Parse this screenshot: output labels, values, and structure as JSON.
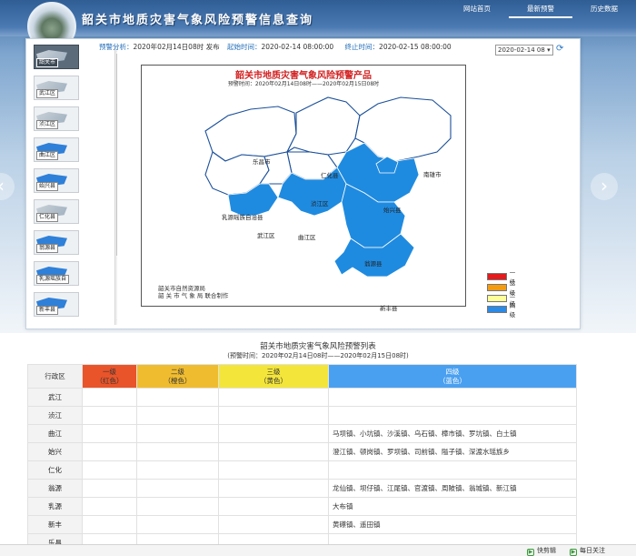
{
  "header": {
    "title": "韶关市地质灾害气象风险预警信息查询"
  },
  "nav": [
    {
      "label": "网站首页"
    },
    {
      "label": "最新预警"
    },
    {
      "label": "历史数据"
    }
  ],
  "thumbs": [
    {
      "label": "韶关市"
    },
    {
      "label": "武江区"
    },
    {
      "label": "浈江区"
    },
    {
      "label": "曲江区"
    },
    {
      "label": "始兴县"
    },
    {
      "label": "仁化县"
    },
    {
      "label": "翁源县"
    },
    {
      "label": "乳源瑶族自"
    },
    {
      "label": "新丰县"
    }
  ],
  "meta": {
    "forecast_label": "预警分析：",
    "forecast_value": "2020年02月14日08时 发布",
    "start_label": "起始时间：",
    "start_value": "2020-02-14 08:00:00",
    "end_label": "终止时间：",
    "end_value": "2020-02-15 08:00:00",
    "date_select": "2020-02-14 08"
  },
  "map": {
    "title": "韶关市地质灾害气象风险预警产品",
    "subtitle": "预警时间：2020年02月14日08时——2020年02月15日08时",
    "labels": [
      {
        "text": "乐昌市"
      },
      {
        "text": "仁化县"
      },
      {
        "text": "南雄市"
      },
      {
        "text": "浈江区"
      },
      {
        "text": "始兴县"
      },
      {
        "text": "乳源瑶族自治县"
      },
      {
        "text": "武江区"
      },
      {
        "text": "曲江区"
      },
      {
        "text": "翁源县"
      },
      {
        "text": "新丰县"
      }
    ],
    "credit_1": "韶关市自然资源局",
    "credit_2": "韶 关 市 气 象 局",
    "credit_3": "联合制作",
    "colors": {
      "region": "#1f8be0",
      "border": "#ffffff",
      "land": "#ffffff"
    }
  },
  "legend": [
    {
      "label": "一级",
      "color": "#e41a1c"
    },
    {
      "label": "二级",
      "color": "#f39c12"
    },
    {
      "label": "三级",
      "color": "#ffff99"
    },
    {
      "label": "四级",
      "color": "#2b8ae6"
    }
  ],
  "table": {
    "title": "韶关市地质灾害气象风险预警列表",
    "subtitle": "(预警时间：2020年02月14日08时——2020年02月15日08时)",
    "headers": [
      {
        "main": "行政区",
        "sub": ""
      },
      {
        "main": "一级",
        "sub": "（红色）"
      },
      {
        "main": "二级",
        "sub": "（橙色）"
      },
      {
        "main": "三级",
        "sub": "（黄色）"
      },
      {
        "main": "四级",
        "sub": "（蓝色）"
      }
    ],
    "rows": [
      {
        "region": "武江",
        "l1": "",
        "l2": "",
        "l3": "",
        "l4": ""
      },
      {
        "region": "浈江",
        "l1": "",
        "l2": "",
        "l3": "",
        "l4": ""
      },
      {
        "region": "曲江",
        "l1": "",
        "l2": "",
        "l3": "",
        "l4": "马坝镇、小坑镇、沙溪镇、乌石镇、樟市镇、罗坑镇、白土镇"
      },
      {
        "region": "始兴",
        "l1": "",
        "l2": "",
        "l3": "",
        "l4": "澄江镇、顿岗镇、罗坝镇、司前镇、隘子镇、深渡水瑶族乡"
      },
      {
        "region": "仁化",
        "l1": "",
        "l2": "",
        "l3": "",
        "l4": ""
      },
      {
        "region": "翁源",
        "l1": "",
        "l2": "",
        "l3": "",
        "l4": "龙仙镇、坝仔镇、江尾镇、官渡镇、周陂镇、翁城镇、新江镇"
      },
      {
        "region": "乳源",
        "l1": "",
        "l2": "",
        "l3": "",
        "l4": "大布镇"
      },
      {
        "region": "新丰",
        "l1": "",
        "l2": "",
        "l3": "",
        "l4": "黄礤镇、遥田镇"
      },
      {
        "region": "乐昌",
        "l1": "",
        "l2": "",
        "l3": "",
        "l4": ""
      }
    ]
  },
  "status": {
    "clip": "快剪辑",
    "follow": "每日关注"
  }
}
